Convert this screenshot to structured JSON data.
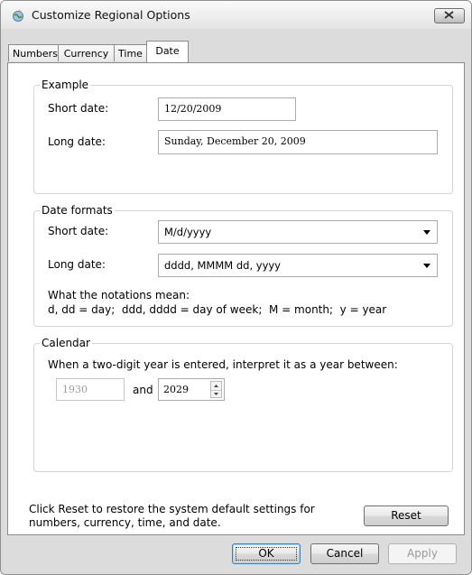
{
  "window": {
    "title": "Customize Regional Options",
    "icon": "regional-options-icon",
    "close_icon": "close-icon"
  },
  "tabs": [
    {
      "label": "Numbers",
      "selected": false
    },
    {
      "label": "Currency",
      "selected": false
    },
    {
      "label": "Time",
      "selected": false
    },
    {
      "label": "Date",
      "selected": true
    }
  ],
  "example": {
    "legend": "Example",
    "short_label": "Short date:",
    "short_value": "12/20/2009",
    "long_label": "Long date:",
    "long_value": "Sunday, December 20, 2009"
  },
  "formats": {
    "legend": "Date formats",
    "short_label": "Short date:",
    "short_value": "M/d/yyyy",
    "long_label": "Long date:",
    "long_value": "dddd, MMMM dd, yyyy",
    "notation_title": "What the notations mean:",
    "notation_text": "d, dd = day;  ddd, dddd = day of week;  M = month;  y = year"
  },
  "calendar": {
    "legend": "Calendar",
    "instruction": "When a two-digit year is entered, interpret it as a year between:",
    "from_year": "1930",
    "and_label": "and",
    "to_year": "2029"
  },
  "reset": {
    "text": "Click Reset to restore the system default settings for numbers, currency, time, and date.",
    "button_label": "Reset"
  },
  "footer": {
    "ok_label": "OK",
    "cancel_label": "Cancel",
    "apply_label": "Apply"
  },
  "colors": {
    "window_frame": "#dcdcdc",
    "panel_background": "#ffffff",
    "default_button_border": "#3c7fb1",
    "disabled_text": "#9a9a9a"
  }
}
